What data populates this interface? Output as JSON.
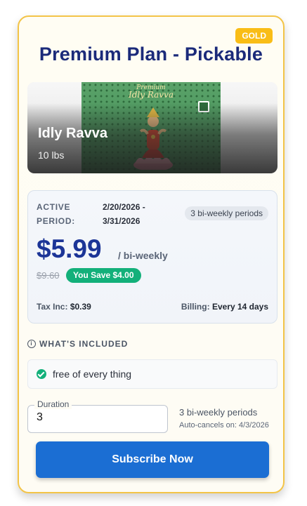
{
  "card": {
    "tier_badge": "GOLD",
    "title": "Premium Plan - Pickable"
  },
  "product": {
    "bag_brand": "Premium",
    "bag_name": "Idly Ravva",
    "name": "Idly Ravva",
    "size": "10 lbs"
  },
  "pricing": {
    "active_label": "ACTIVE PERIOD:",
    "active_dates": "2/20/2026 - 3/31/2026",
    "periods_chip": "3 bi-weekly periods",
    "price": "$5.99",
    "per": "/ bi-weekly",
    "old_price": "$9.60",
    "savings": "You Save $4.00",
    "tax_label": "Tax Inc:",
    "tax_value": "$0.39",
    "billing_label": "Billing:",
    "billing_value": "Every 14 days"
  },
  "included": {
    "heading": "WHAT'S INCLUDED",
    "features": [
      "free of every thing"
    ]
  },
  "duration": {
    "label": "Duration",
    "value": "3",
    "periods": "3 bi-weekly periods",
    "auto_cancel": "Auto-cancels on: 4/3/2026"
  },
  "cta": {
    "label": "Subscribe Now"
  },
  "colors": {
    "title": "#1b2a7a",
    "price": "#1c3597",
    "gold": "#f9bd16",
    "savings": "#13b07a",
    "button": "#1b6ed3",
    "border": "#f3c447"
  }
}
